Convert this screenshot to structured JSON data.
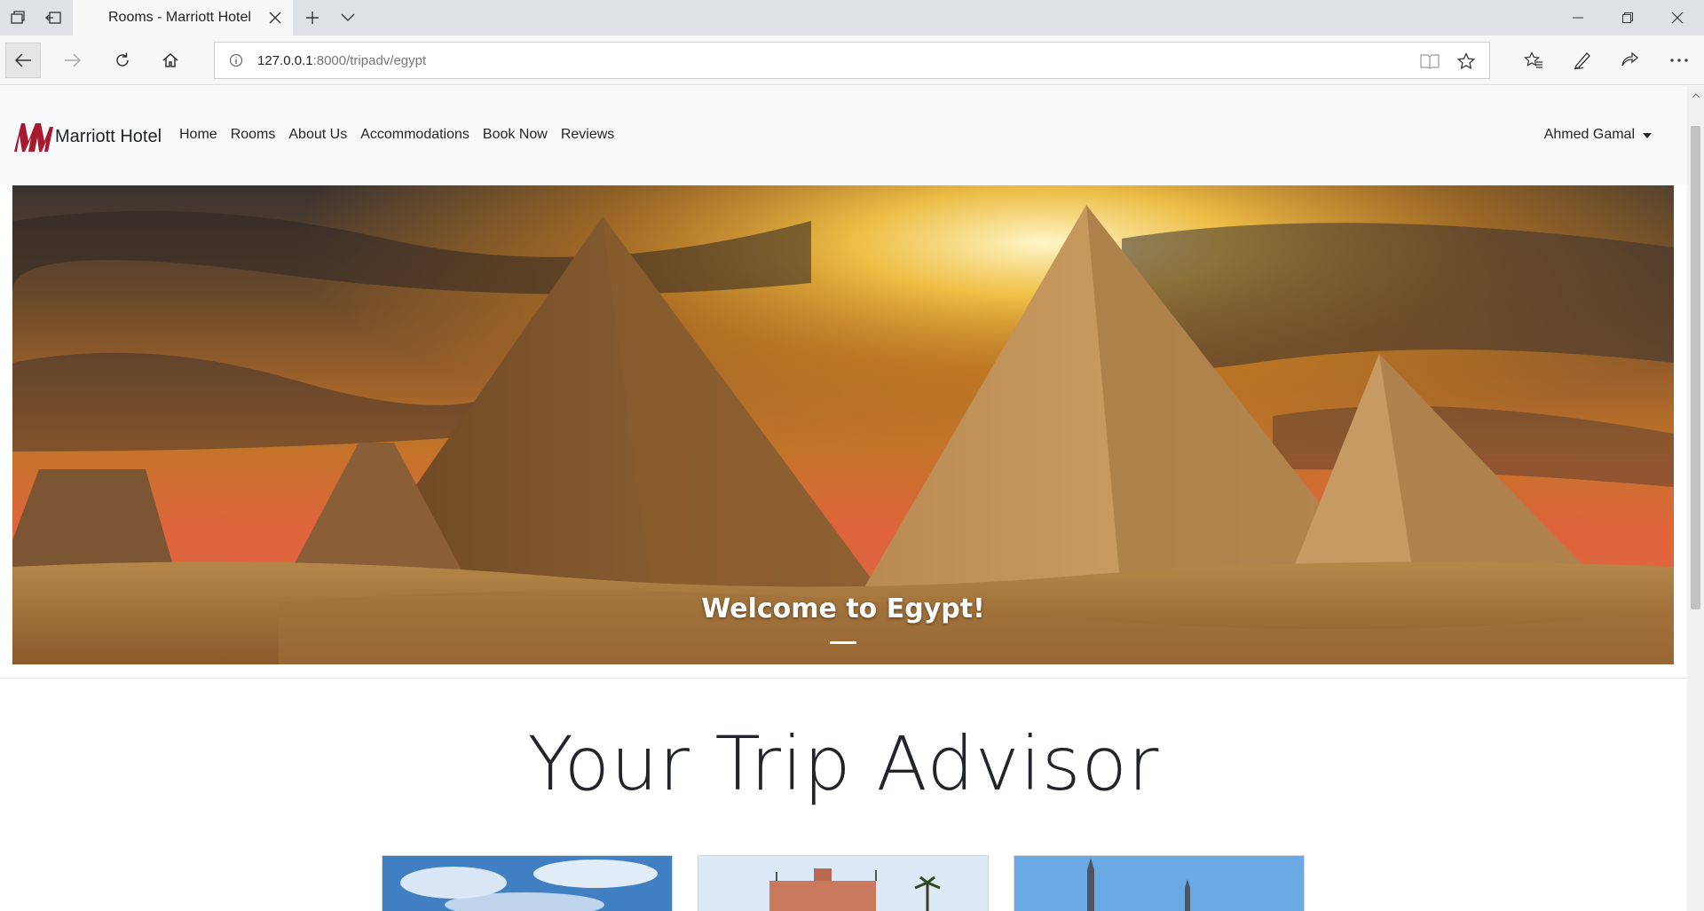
{
  "browser": {
    "tab_title": "Rooms - Marriott Hotel",
    "url_host": "127.0.0.1",
    "url_rest": ":8000/tripadv/egypt"
  },
  "site": {
    "brand": "Marriott Hotel",
    "menu": [
      "Home",
      "Rooms",
      "About Us",
      "Accommodations",
      "Book Now",
      "Reviews"
    ],
    "user": "Ahmed Gamal"
  },
  "hero": {
    "caption": "Welcome to Egypt!"
  },
  "section": {
    "title": "Your Trip Advisor"
  },
  "colors": {
    "brand_red": "#a6192e",
    "nav_bg": "#f8f9fa"
  }
}
